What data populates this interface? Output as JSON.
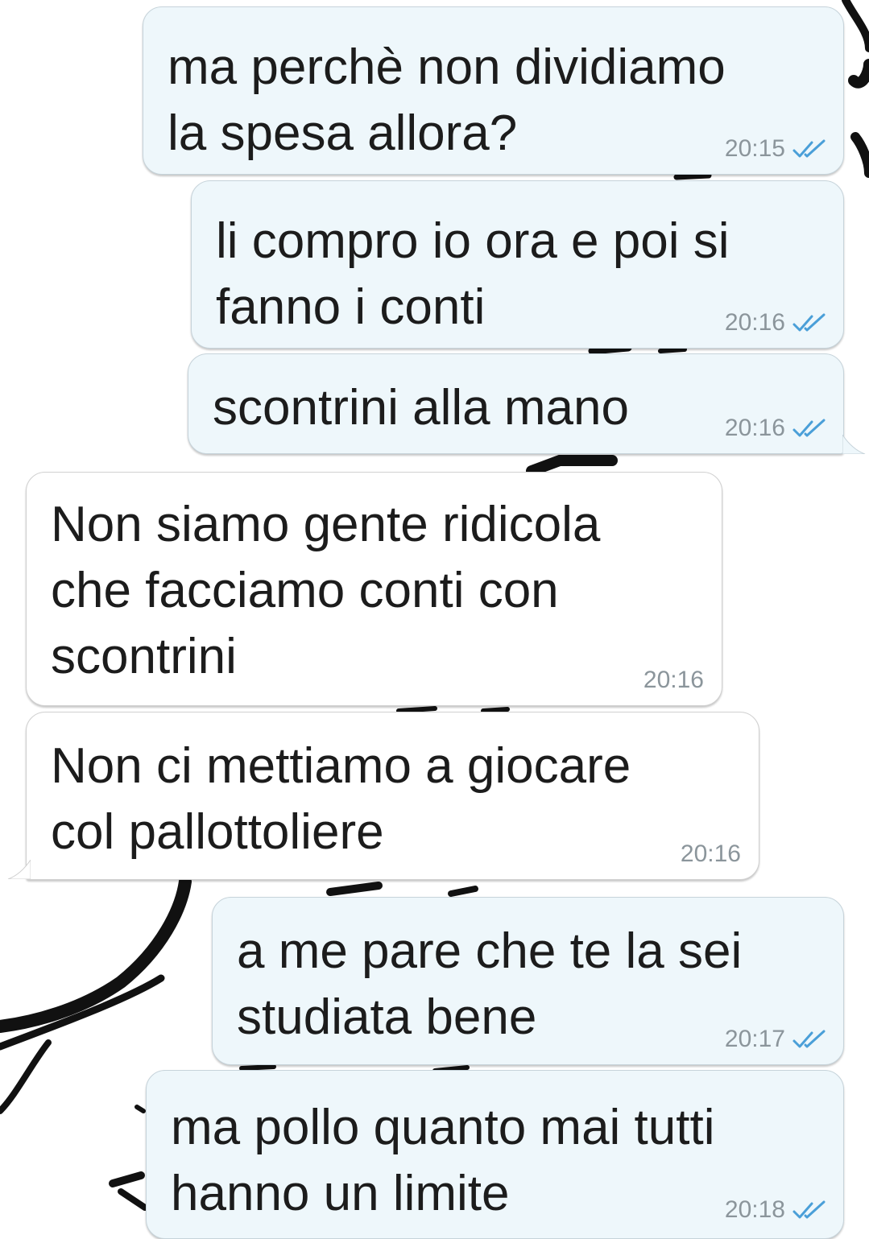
{
  "chat": {
    "messages": [
      {
        "direction": "outgoing",
        "text": "ma perchè non dividiamo\nla spesa allora?",
        "time": "20:15",
        "status": "read-double-tick"
      },
      {
        "direction": "outgoing",
        "text": "li compro io ora e poi si\nfanno i conti",
        "time": "20:16",
        "status": "read-double-tick"
      },
      {
        "direction": "outgoing",
        "text": "scontrini alla mano",
        "time": "20:16",
        "status": "read-double-tick"
      },
      {
        "direction": "incoming",
        "text": "Non siamo gente ridicola\nche facciamo conti con\nscontrini",
        "time": "20:16"
      },
      {
        "direction": "incoming",
        "text": "Non ci mettiamo a giocare\ncol pallottoliere",
        "time": "20:16"
      },
      {
        "direction": "outgoing",
        "text": "a me pare che te la sei\nstudiata bene",
        "time": "20:17",
        "status": "read-double-tick"
      },
      {
        "direction": "outgoing",
        "text": "ma pollo quanto mai tutti\nhanno un limite",
        "time": "20:18",
        "status": "read-double-tick"
      }
    ]
  },
  "colors": {
    "outgoing_bubble": "#eef7fb",
    "incoming_bubble": "#ffffff",
    "read_tick": "#4a9fd8",
    "timestamp": "#8b959b",
    "wallpaper_ink": "#111111"
  },
  "icons": {
    "read_status": "double-check-icon"
  }
}
